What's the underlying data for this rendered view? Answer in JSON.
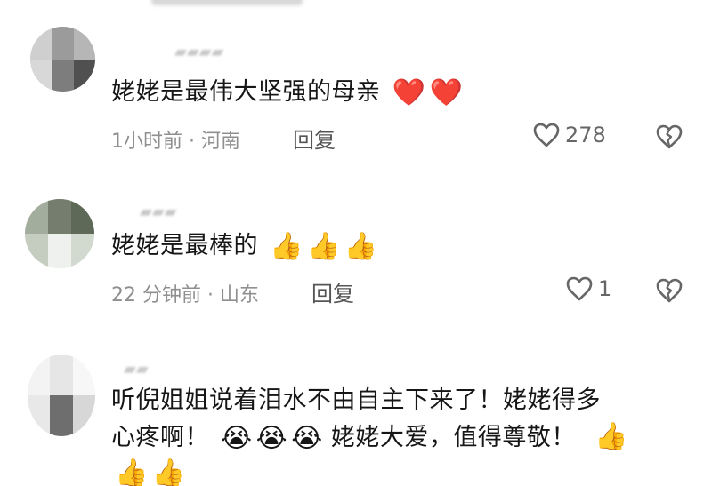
{
  "comments": [
    {
      "text": "姥姥是最伟大坚强的母亲",
      "emojis": [
        "❤️",
        "❤️"
      ],
      "meta": "1小时前 · 河南",
      "reply_label": "回复",
      "like_count": "278"
    },
    {
      "text": "姥姥是最棒的",
      "emojis": [
        "👍",
        "👍",
        "👍"
      ],
      "meta": "22 分钟前 · 山东",
      "reply_label": "回复",
      "like_count": "1"
    },
    {
      "text_line_1": "听倪姐姐说着泪水不由自主下来了！姥姥得多",
      "text_line_2_prefix": "心疼啊！",
      "text_line_2_emojis": [
        "😭",
        "😭",
        "😭"
      ],
      "text_line_2_suffix": "姥姥大爱，值得尊敬！",
      "trailing_emoji": "👍",
      "bottom_emojis": [
        "👍",
        "👍"
      ]
    }
  ],
  "colors": {
    "text": "#161616",
    "meta": "#8f8f8f",
    "reply": "#555555",
    "like_icon": "#666666"
  },
  "icons": {
    "like": "heart-outline-icon",
    "dislike": "broken-heart-icon"
  }
}
